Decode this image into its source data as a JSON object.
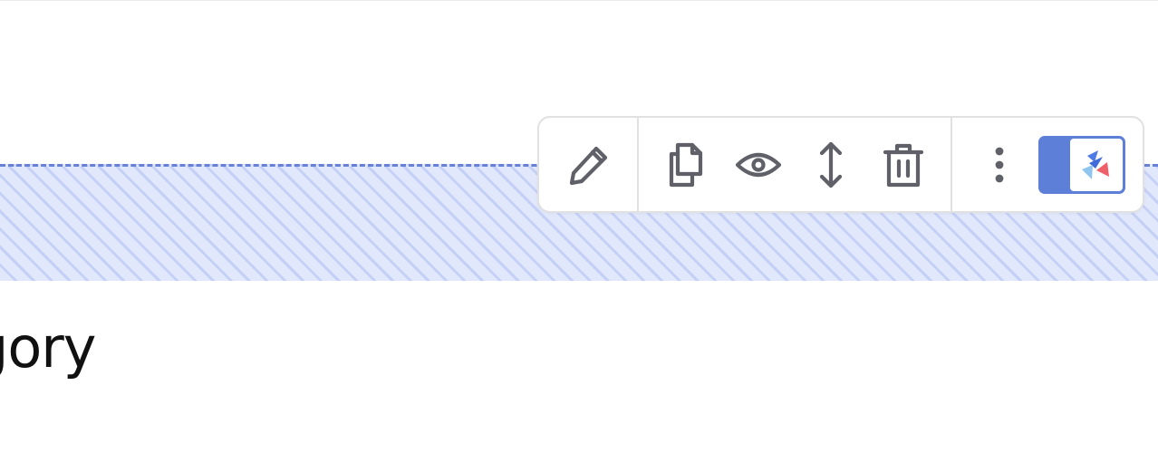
{
  "page": {
    "heading_text": "gory"
  },
  "toolbar": {
    "icons": {
      "edit": "pencil-icon",
      "duplicate": "copy-icon",
      "preview": "eye-icon",
      "move": "vertical-arrows-icon",
      "delete": "trash-icon",
      "more": "vertical-dots-icon",
      "extension": "app-logo-icon"
    }
  },
  "colors": {
    "accent": "#5e7fd8",
    "selection_fill": "#e2e8fb",
    "selection_stripe": "#c4d0f6",
    "icon": "#5f6068",
    "toolbar_border": "#e1e1e1",
    "logo_blue": "#4f7be4",
    "logo_light_blue": "#8fc5ef",
    "logo_red": "#ee5f69"
  }
}
